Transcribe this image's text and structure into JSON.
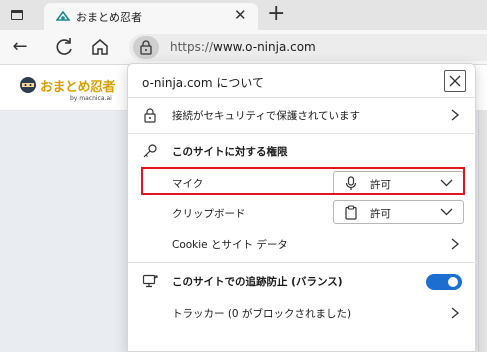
{
  "browser": {
    "tab": {
      "title": "おまとめ忍者"
    },
    "address": {
      "scheme": "https://",
      "host": "www.o-ninja.com"
    }
  },
  "site": {
    "logo_text": "おまとめ忍者",
    "logo_sub": "by macnica.ai"
  },
  "panel": {
    "title": "o-ninja.com について",
    "connection_label": "接続がセキュリティで保護されています",
    "permissions_heading": "このサイトに対する権限",
    "permissions": [
      {
        "label": "マイク",
        "value": "許可",
        "icon": "microphone-icon"
      },
      {
        "label": "クリップボード",
        "value": "許可",
        "icon": "clipboard-icon"
      }
    ],
    "cookie_label": "Cookie とサイト データ",
    "tracking_heading": "このサイトでの追跡防止 (バランス)",
    "tracking_enabled": true,
    "trackers_label": "トラッカー (0 がブロックされました)"
  },
  "colors": {
    "highlight": "#e0141e",
    "toggle_on": "#1c6fd1",
    "logo": "#d8a000"
  }
}
